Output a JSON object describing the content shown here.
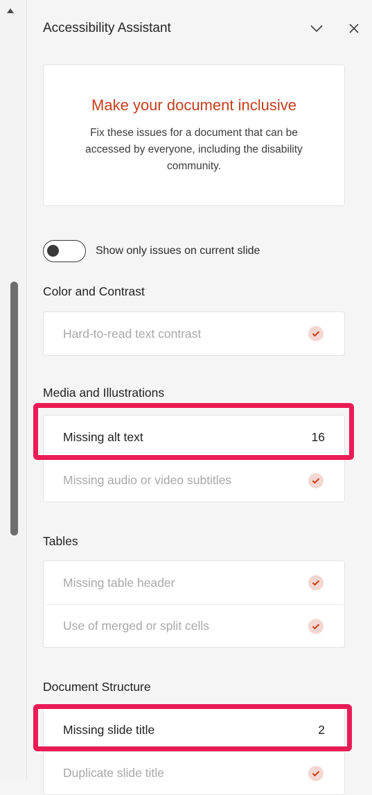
{
  "pane": {
    "title": "Accessibility Assistant"
  },
  "intro": {
    "heading": "Make your document inclusive",
    "body": "Fix these issues for a document that can be accessed by everyone, including the disability community."
  },
  "toggle": {
    "label": "Show only issues on current slide",
    "state": "off"
  },
  "sections": {
    "color": {
      "title": "Color and Contrast",
      "items": [
        {
          "label": "Hard-to-read text contrast",
          "status": "checked"
        }
      ]
    },
    "media": {
      "title": "Media and Illustrations",
      "items": [
        {
          "label": "Missing alt text",
          "count": "16"
        },
        {
          "label": "Missing audio or video subtitles",
          "status": "checked"
        }
      ]
    },
    "tables": {
      "title": "Tables",
      "items": [
        {
          "label": "Missing table header",
          "status": "checked"
        },
        {
          "label": "Use of merged or split cells",
          "status": "checked"
        }
      ]
    },
    "structure": {
      "title": "Document Structure",
      "items": [
        {
          "label": "Missing slide title",
          "count": "2"
        },
        {
          "label": "Duplicate slide title",
          "status": "checked"
        }
      ]
    }
  },
  "colors": {
    "heading_accent": "#c43e1c",
    "highlight": "#ea1b56",
    "check_bg": "#f4d7d2",
    "check_mark": "#c43e1c"
  },
  "icons": [
    "scroll-up-icon",
    "chevron-down-icon",
    "close-icon",
    "checkmark-icon"
  ]
}
